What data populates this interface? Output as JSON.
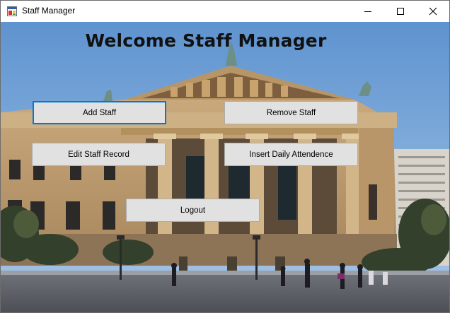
{
  "window": {
    "title": "Staff Manager",
    "controls": {
      "minimize": "minimize-icon",
      "maximize": "maximize-icon",
      "close": "close-icon"
    }
  },
  "main": {
    "heading": "Welcome Staff Manager",
    "buttons": {
      "add_staff": "Add Staff",
      "remove_staff": "Remove Staff",
      "edit_staff_record": "Edit Staff Record",
      "insert_daily_attendence": "Insert Daily Attendence",
      "logout": "Logout"
    }
  },
  "colors": {
    "focus_border": "#0078d7",
    "button_face": "#e1e1e1",
    "button_border": "#adadad"
  }
}
